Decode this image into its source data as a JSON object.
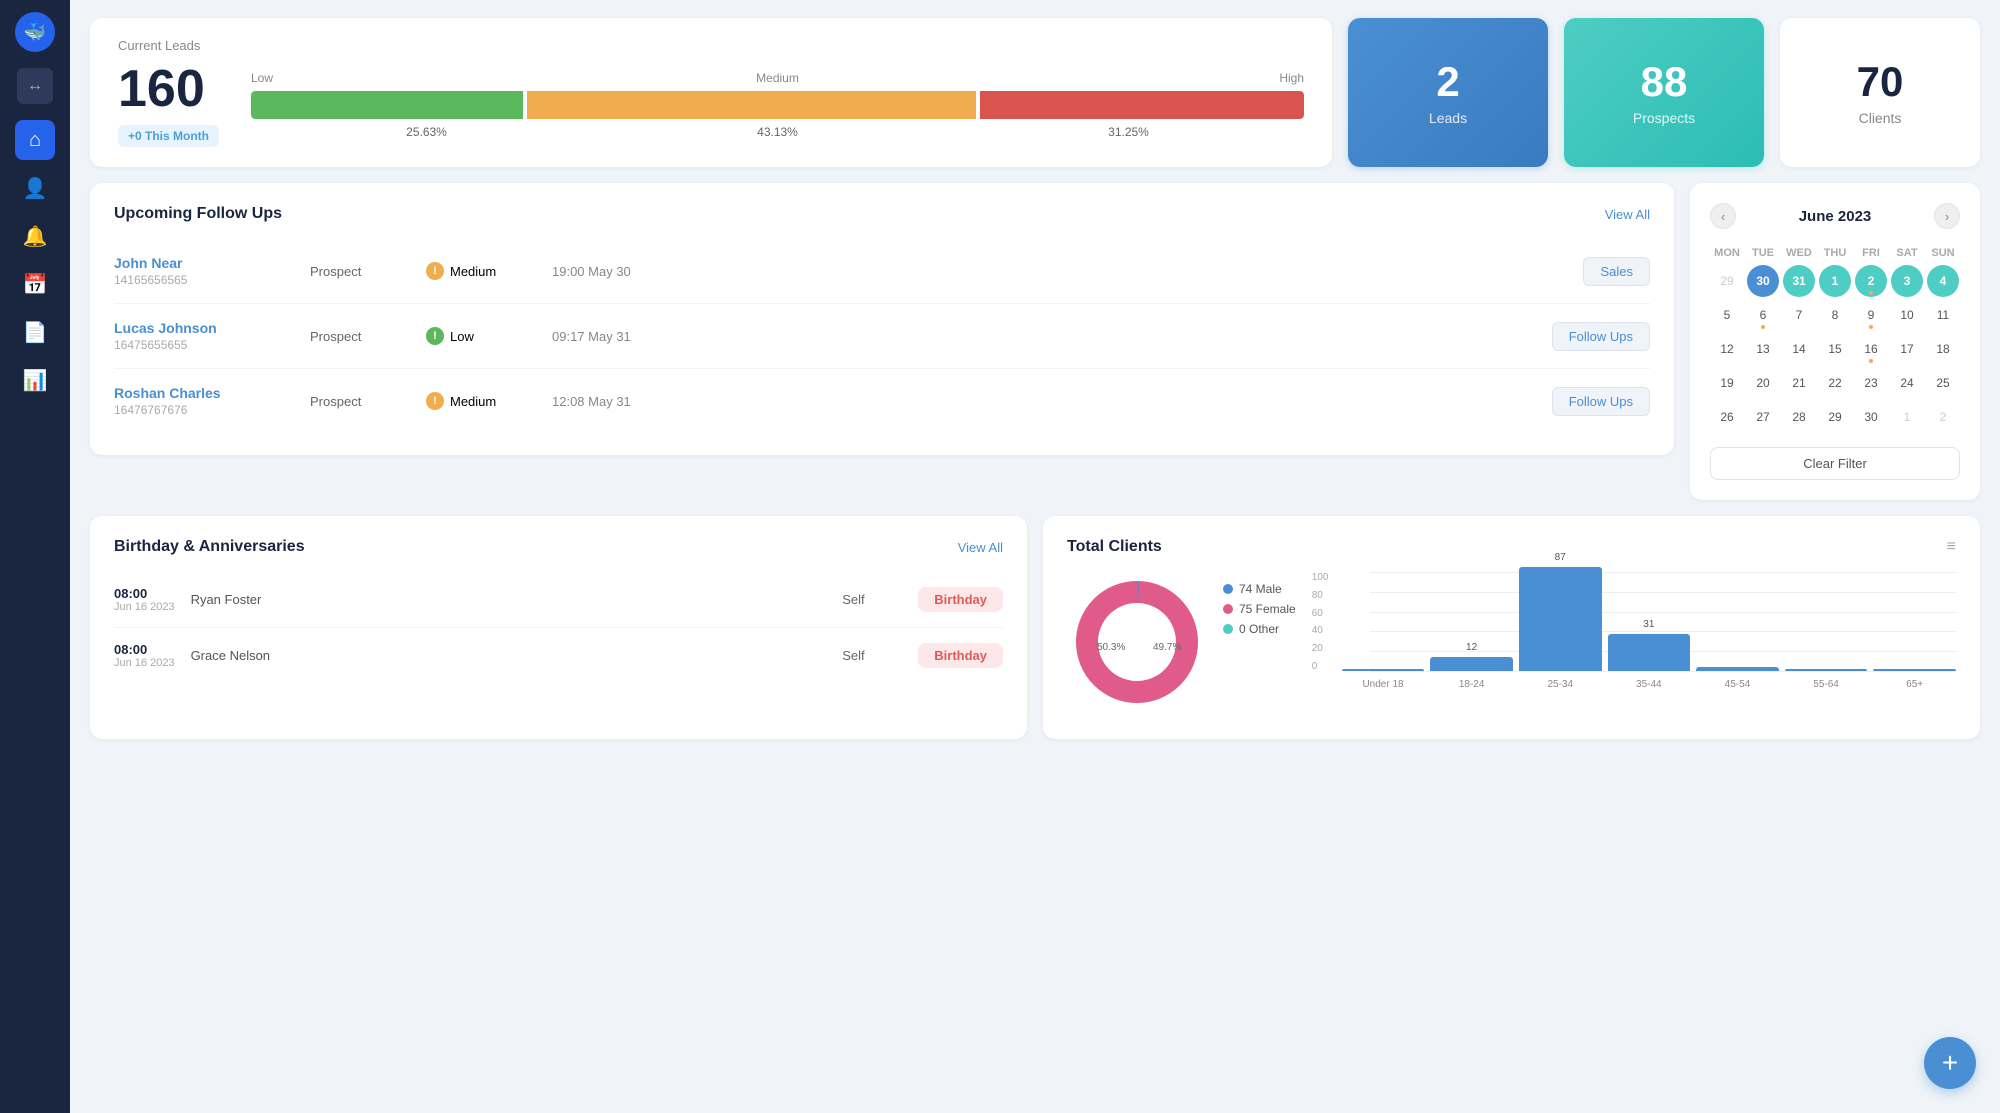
{
  "sidebar": {
    "logo_icon": "🐳",
    "toggle_icon": "↔",
    "items": [
      {
        "name": "home",
        "icon": "⌂",
        "active": true
      },
      {
        "name": "person",
        "icon": "👤",
        "active": false
      },
      {
        "name": "bell",
        "icon": "🔔",
        "active": false
      },
      {
        "name": "calendar",
        "icon": "📅",
        "active": false
      },
      {
        "name": "file",
        "icon": "📄",
        "active": false
      },
      {
        "name": "chart",
        "icon": "📊",
        "active": false
      }
    ]
  },
  "current_leads": {
    "title": "Current Leads",
    "count": "160",
    "badge": "+0 This Month",
    "progress": {
      "low_label": "Low",
      "medium_label": "Medium",
      "high_label": "High",
      "low_pct": "25.63%",
      "medium_pct": "43.13%",
      "high_pct": "31.25%",
      "low_width": 26,
      "medium_width": 43,
      "high_width": 31
    }
  },
  "stats": {
    "leads": {
      "count": "2",
      "label": "Leads"
    },
    "prospects": {
      "count": "88",
      "label": "Prospects"
    },
    "clients": {
      "count": "70",
      "label": "Clients"
    }
  },
  "followups": {
    "section_title": "Upcoming Follow Ups",
    "view_all": "View All",
    "rows": [
      {
        "name": "John Near",
        "phone": "14165656565",
        "type": "Prospect",
        "priority": "Medium",
        "priority_class": "medium",
        "time": "19:00 May 30",
        "action": "Sales"
      },
      {
        "name": "Lucas Johnson",
        "phone": "16475655655",
        "type": "Prospect",
        "priority": "Low",
        "priority_class": "low",
        "time": "09:17 May 31",
        "action": "Follow Ups"
      },
      {
        "name": "Roshan Charles",
        "phone": "16476767676",
        "type": "Prospect",
        "priority": "Medium",
        "priority_class": "medium",
        "time": "12:08 May 31",
        "action": "Follow Ups"
      }
    ]
  },
  "calendar": {
    "title": "June 2023",
    "prev_icon": "‹",
    "next_icon": "›",
    "day_headers": [
      "MON",
      "TUE",
      "WED",
      "THU",
      "FRI",
      "SAT",
      "SUN"
    ],
    "weeks": [
      [
        {
          "day": "29",
          "empty": true
        },
        {
          "day": "30",
          "today": true
        },
        {
          "day": "31",
          "highlighted": true
        },
        {
          "day": "1",
          "highlighted": true
        },
        {
          "day": "2",
          "highlighted": true,
          "has_dot": true
        },
        {
          "day": "3",
          "highlighted": true
        },
        {
          "day": "4",
          "highlighted": true
        }
      ],
      [
        {
          "day": "5"
        },
        {
          "day": "6",
          "has_dot": true
        },
        {
          "day": "7"
        },
        {
          "day": "8"
        },
        {
          "day": "9",
          "has_dot": true
        },
        {
          "day": "10"
        },
        {
          "day": "11"
        }
      ],
      [
        {
          "day": "12"
        },
        {
          "day": "13"
        },
        {
          "day": "14"
        },
        {
          "day": "15"
        },
        {
          "day": "16",
          "has_dot": true
        },
        {
          "day": "17"
        },
        {
          "day": "18"
        }
      ],
      [
        {
          "day": "19"
        },
        {
          "day": "20"
        },
        {
          "day": "21"
        },
        {
          "day": "22"
        },
        {
          "day": "23"
        },
        {
          "day": "24"
        },
        {
          "day": "25"
        }
      ],
      [
        {
          "day": "26"
        },
        {
          "day": "27"
        },
        {
          "day": "28"
        },
        {
          "day": "29",
          "empty2": true
        },
        {
          "day": "30"
        },
        {
          "day": "1",
          "empty2": true
        },
        {
          "day": "2",
          "empty2": true
        }
      ]
    ],
    "clear_filter": "Clear Filter"
  },
  "birthdays": {
    "section_title": "Birthday & Anniversaries",
    "view_all": "View All",
    "rows": [
      {
        "time": "08:00",
        "date": "Jun 16 2023",
        "name": "Ryan Foster",
        "type": "Self",
        "badge": "Birthday"
      },
      {
        "time": "08:00",
        "date": "Jun 16 2023",
        "name": "Grace Nelson",
        "type": "Self",
        "badge": "Birthday"
      }
    ]
  },
  "total_clients": {
    "title": "Total Clients",
    "menu_icon": "≡",
    "donut": {
      "male_pct": 49.7,
      "female_pct": 50.3,
      "male_label": "49.7%",
      "female_label": "50.3%"
    },
    "legend": [
      {
        "color": "#4a8fd4",
        "label": "74 Male"
      },
      {
        "color": "#e05a8a",
        "label": "75 Female"
      },
      {
        "color": "#4ecdc4",
        "label": "0 Other"
      }
    ],
    "bar_chart": {
      "y_labels": [
        "100",
        "80",
        "60",
        "40",
        "20",
        "0"
      ],
      "bars": [
        {
          "label": "Under 18",
          "value": 0,
          "height": 0,
          "display": ""
        },
        {
          "label": "18-24",
          "value": 12,
          "height": 14,
          "display": "12"
        },
        {
          "label": "25-34",
          "value": 87,
          "height": 104,
          "display": "87"
        },
        {
          "label": "35-44",
          "value": 31,
          "height": 37,
          "display": "31"
        },
        {
          "label": "45-54",
          "value": 3,
          "height": 4,
          "display": ""
        },
        {
          "label": "55-64",
          "value": 0,
          "height": 0,
          "display": ""
        },
        {
          "label": "65+",
          "value": 0,
          "height": 0,
          "display": ""
        }
      ]
    }
  },
  "fab": {
    "icon": "+"
  }
}
